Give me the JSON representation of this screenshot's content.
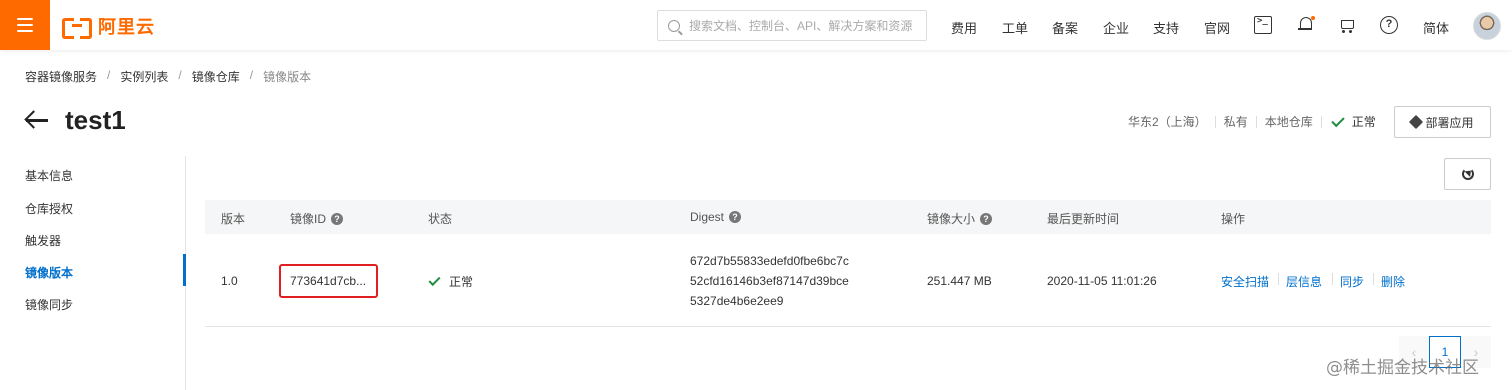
{
  "header": {
    "logo_text": "阿里云",
    "search_placeholder": "搜索文档、控制台、API、解决方案和资源",
    "nav": [
      "费用",
      "工单",
      "备案",
      "企业",
      "支持",
      "官网"
    ],
    "lang": "简体"
  },
  "breadcrumb": [
    "容器镜像服务",
    "实例列表",
    "镜像仓库",
    "镜像版本"
  ],
  "page": {
    "title": "test1",
    "region": "华东2（上海）",
    "visibility": "私有",
    "repo_type": "本地仓库",
    "status": "正常",
    "deploy_label": "部署应用"
  },
  "sidenav": {
    "items": [
      "基本信息",
      "仓库授权",
      "触发器",
      "镜像版本",
      "镜像同步"
    ],
    "active": "镜像版本"
  },
  "table": {
    "headers": {
      "version": "版本",
      "image_id": "镜像ID",
      "status": "状态",
      "digest": "Digest",
      "size": "镜像大小",
      "updated": "最后更新时间",
      "actions": "操作"
    },
    "rows": [
      {
        "version": "1.0",
        "image_id": "773641d7cb...",
        "status": "正常",
        "digest_lines": [
          "672d7b55833edefd0fbe6bc7c",
          "52cfd16146b3ef87147d39bce",
          "5327de4b6e2ee9"
        ],
        "size": "251.447 MB",
        "updated": "2020-11-05 11:01:26",
        "actions": [
          "安全扫描",
          "层信息",
          "同步",
          "删除"
        ]
      }
    ]
  },
  "pagination": {
    "current": "1"
  },
  "watermark": "@稀土掘金技术社区",
  "colors": {
    "brand": "#ff6a00",
    "link": "#0070cc",
    "success": "#1e8e3e",
    "highlight": "#e02020"
  }
}
